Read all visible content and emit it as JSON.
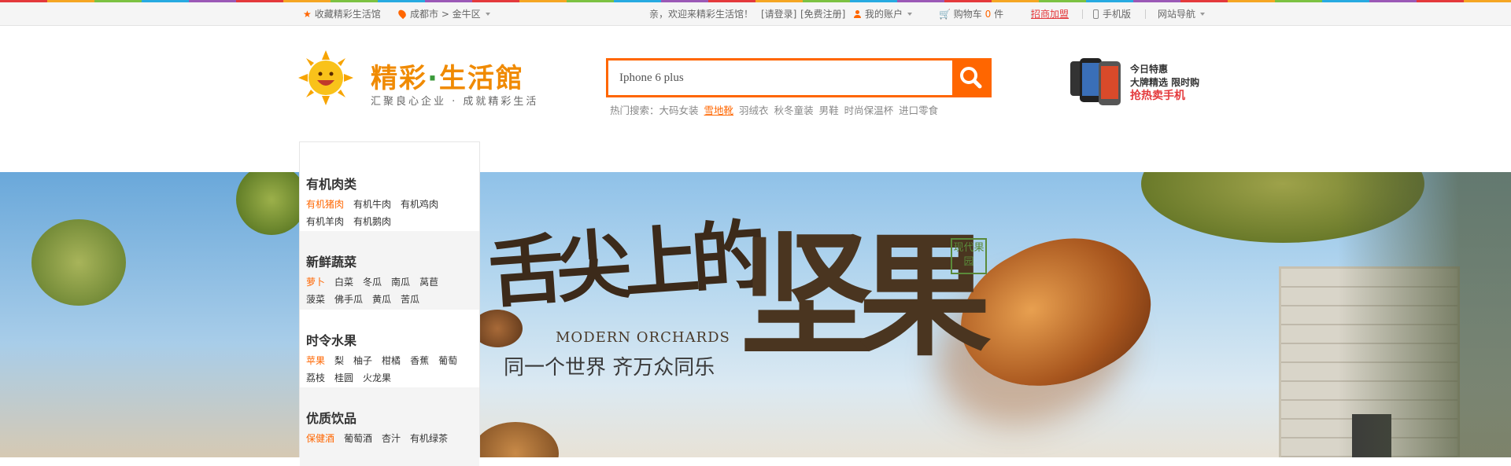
{
  "topbar": {
    "favorite": "收藏精彩生活馆",
    "location": "成都市 > 金牛区",
    "welcome": "亲，欢迎来精彩生活馆！",
    "login": "[请登录]",
    "register": "[免费注册]",
    "account": "我的账户",
    "cart_label": "购物车",
    "cart_count": "0",
    "cart_unit": "件",
    "join": "招商加盟",
    "mobile": "手机版",
    "site_nav": "网站导航"
  },
  "logo": {
    "name_a": "精彩",
    "name_dot": "·",
    "name_b": "生活館",
    "slogan": "汇聚良心企业 · 成就精彩生活"
  },
  "search": {
    "value": "Iphone 6 plus",
    "hot_label": "热门搜索：",
    "hot_terms": [
      "大码女装",
      "雪地靴",
      "羽绒衣",
      "秋冬童装",
      "男鞋",
      "时尚保温杯",
      "进口零食"
    ],
    "highlight_index": 1
  },
  "promo": {
    "line1": "今日特惠",
    "line2": "大牌精选 限时购",
    "line3": "抢热卖手机"
  },
  "banner": {
    "title_a": "舌尖上的",
    "title_b": "坚果",
    "seal": "现代果园",
    "english": "MODERN ORCHARDS",
    "slogan": "同一个世界 齐万众同乐"
  },
  "categories": [
    {
      "title": "有机肉类",
      "items": [
        "有机猪肉",
        "有机牛肉",
        "有机鸡肉",
        "有机羊肉",
        "有机鹅肉"
      ]
    },
    {
      "title": "新鲜蔬菜",
      "items": [
        "萝卜",
        "白菜",
        "冬瓜",
        "南瓜",
        "莴苣",
        "菠菜",
        "佛手瓜",
        "黄瓜",
        "苦瓜"
      ]
    },
    {
      "title": "时令水果",
      "items": [
        "苹果",
        "梨",
        "柚子",
        "柑橘",
        "香蕉",
        "葡萄",
        "荔枝",
        "桂圆",
        "火龙果"
      ]
    },
    {
      "title": "优质饮品",
      "items": [
        "保健酒",
        "葡萄酒",
        "杏汁",
        "有机绿茶"
      ]
    }
  ],
  "colors": {
    "accent": "#ff6600",
    "brand_orange": "#f08a00",
    "brand_green": "#3a9a3a"
  }
}
